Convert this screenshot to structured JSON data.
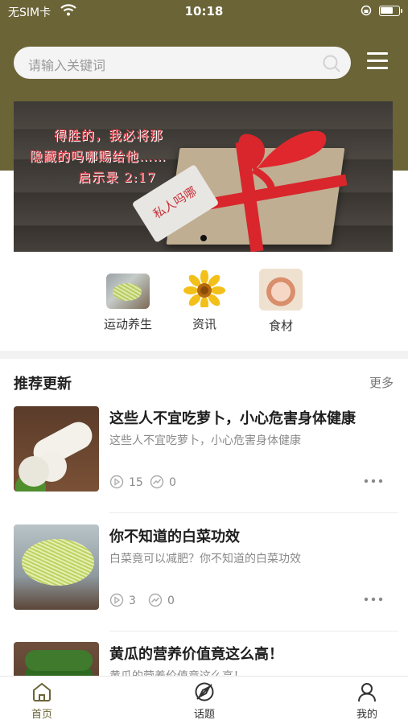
{
  "status_bar": {
    "carrier": "无SIM卡",
    "time": "10:18"
  },
  "search": {
    "placeholder": "请输入关键词"
  },
  "banner": {
    "quote_lines": [
      "得胜的，我必将那",
      "隐藏的吗哪赐给他……",
      "启示录 2:17"
    ],
    "tag_text": "私人吗哪"
  },
  "categories": [
    {
      "label": "运动养生",
      "icon": "salad-photo-icon"
    },
    {
      "label": "资讯",
      "icon": "sunflower-icon"
    },
    {
      "label": "食材",
      "icon": "food-bowl-photo-icon"
    }
  ],
  "section": {
    "title": "推荐更新",
    "more": "更多"
  },
  "articles": [
    {
      "title": "这些人不宜吃萝卜，小心危害身体健康",
      "summary": "这些人不宜吃萝卜，小心危害身体健康",
      "views": "15",
      "shares": "0"
    },
    {
      "title": "你不知道的白菜功效",
      "summary": "白菜竟可以减肥？你不知道的白菜功效",
      "views": "3",
      "shares": "0"
    },
    {
      "title": "黄瓜的营养价值竟这么高！",
      "summary": "黄瓜的营养价值竟这么高！",
      "views": "",
      "shares": ""
    }
  ],
  "tabbar": [
    {
      "label": "首页",
      "icon": "home-icon",
      "active": true
    },
    {
      "label": "话题",
      "icon": "topic-compass-icon",
      "active": false
    },
    {
      "label": "我的",
      "icon": "profile-icon",
      "active": false
    }
  ],
  "colors": {
    "theme": "#6b6437",
    "ribbon": "#d8262c"
  }
}
